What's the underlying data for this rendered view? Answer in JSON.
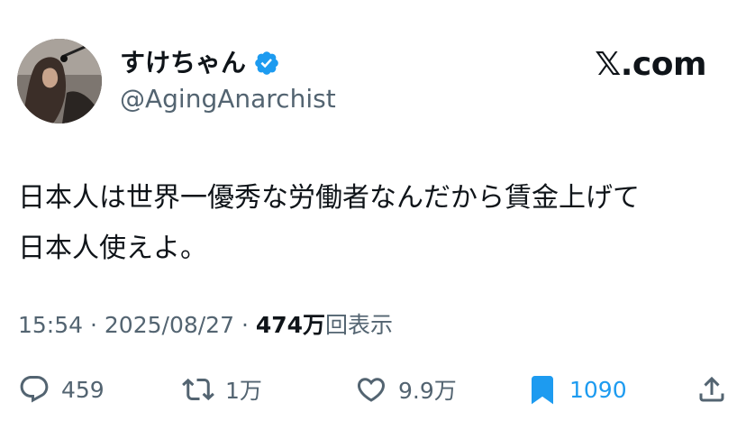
{
  "author": {
    "display_name": "すけちゃん",
    "handle": "@AgingAnarchist",
    "verified_icon": "verified-badge-icon",
    "avatar_icon": "avatar-photo"
  },
  "brand": "𝕏.com",
  "tweet": {
    "lines": [
      "日本人は世界一優秀な労働者なんだから賃金上げて",
      "日本人使えよ。"
    ]
  },
  "meta": {
    "time": "15:54",
    "separator": "·",
    "date": "2025/08/27",
    "views_value": "474万",
    "views_label": "回表示"
  },
  "actions": {
    "reply": {
      "icon": "reply-icon",
      "count": "459"
    },
    "retweet": {
      "icon": "retweet-icon",
      "count": "1万"
    },
    "like": {
      "icon": "heart-icon",
      "count": "9.9万"
    },
    "bookmark": {
      "icon": "bookmark-icon",
      "count": "1090",
      "active_color": "#1d9bf0"
    },
    "share": {
      "icon": "share-icon"
    }
  },
  "colors": {
    "text": "#0f1419",
    "secondary": "#536471",
    "accent": "#1d9bf0"
  }
}
